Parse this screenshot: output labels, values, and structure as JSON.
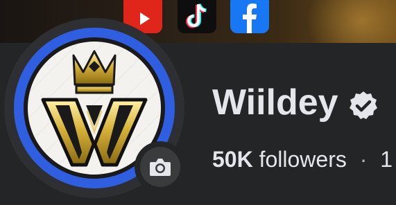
{
  "cover": {
    "social_icons": [
      {
        "icon": "youtube-icon",
        "color": "#e0261b"
      },
      {
        "icon": "tiktok-icon",
        "color": "#0e0e0e"
      },
      {
        "icon": "facebook-icon",
        "color": "#1877f2"
      }
    ]
  },
  "profile": {
    "name": "Wiildey",
    "verified_icon": "verified-badge-icon",
    "avatar_ring_color": "#2f5fe0",
    "camera_icon": "camera-icon",
    "followers_count": "50K",
    "followers_label": "followers",
    "separator": "·",
    "following_partial": "1"
  }
}
